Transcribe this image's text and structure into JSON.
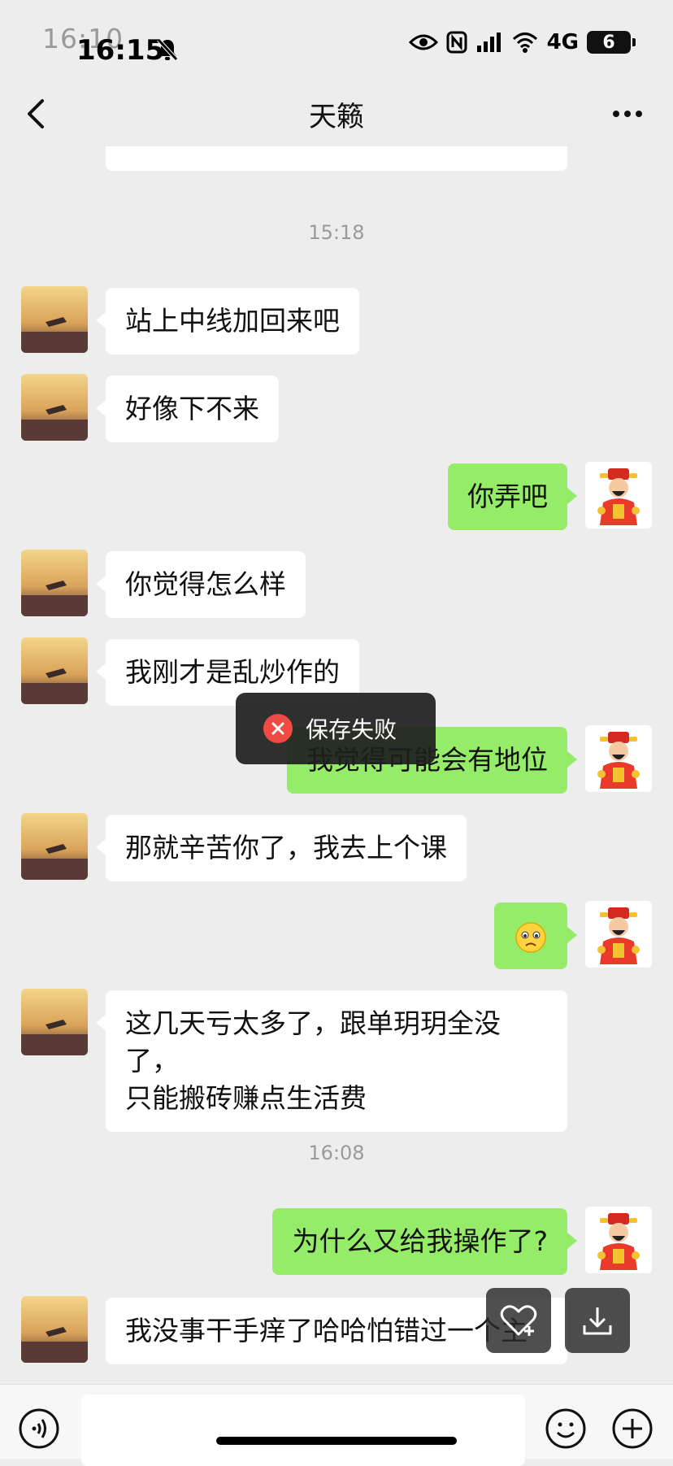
{
  "status_bar": {
    "time_ghost": "16:10",
    "time": "16:15",
    "network": "4G",
    "battery": "6"
  },
  "header": {
    "title": "天籁"
  },
  "messages": [
    {
      "type": "timestamp",
      "text": "15:18"
    },
    {
      "side": "left",
      "text": "站上中线加回来吧"
    },
    {
      "side": "left",
      "text": "好像下不来"
    },
    {
      "side": "right",
      "text": "你弄吧"
    },
    {
      "side": "left",
      "text": "你觉得怎么样"
    },
    {
      "side": "left",
      "text": "我刚才是乱炒作的"
    },
    {
      "side": "right",
      "text": "我觉得可能会有地位"
    },
    {
      "side": "left",
      "text": "那就辛苦你了，我去上个课"
    },
    {
      "side": "right",
      "text": "🙁",
      "emoji": "worried-face"
    },
    {
      "side": "left",
      "lines": [
        "这几天亏太多了，跟单玥玥全没了，",
        "只能搬砖赚点生活费"
      ]
    },
    {
      "type": "timestamp",
      "text": "16:08"
    },
    {
      "side": "right",
      "text": "为什么又给我操作了?"
    },
    {
      "side": "left",
      "text": "我没事干手痒了哈哈怕错过一个主"
    }
  ],
  "toast": {
    "text": "保存失败",
    "icon": "error-x-icon"
  },
  "colors": {
    "background": "#ededed",
    "bubble_self": "#95ec69",
    "bubble_other": "#ffffff",
    "toast_error": "#f04a45"
  }
}
